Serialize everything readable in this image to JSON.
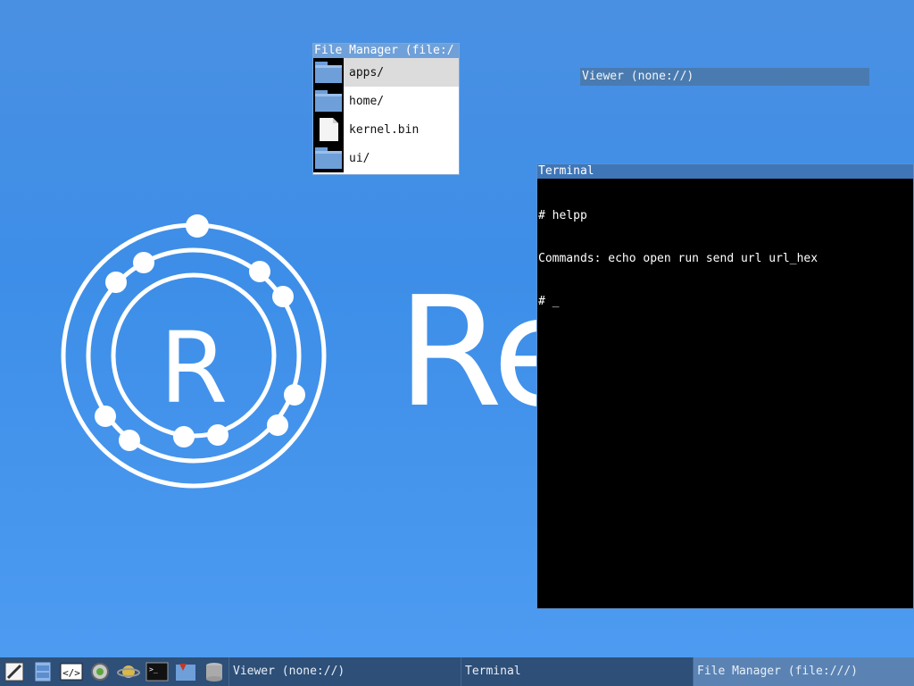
{
  "wallpaper": {
    "brand_text": "Re"
  },
  "file_manager": {
    "title": "File Manager (file:/",
    "entries": [
      {
        "label": "apps/",
        "icon": "folder-icon"
      },
      {
        "label": "home/",
        "icon": "folder-icon"
      },
      {
        "label": "kernel.bin",
        "icon": "file-icon"
      },
      {
        "label": "ui/",
        "icon": "folder-icon"
      }
    ]
  },
  "viewer": {
    "title": "Viewer (none://)"
  },
  "terminal": {
    "title": "Terminal",
    "lines": [
      "# helpp",
      "Commands: echo open run send url url_hex",
      "# _"
    ]
  },
  "taskbar": {
    "launchers": [
      "text-editor-icon",
      "file-manager-icon",
      "code-editor-icon",
      "settings-icon",
      "planet-icon",
      "terminal-icon",
      "paint-icon",
      "database-icon"
    ],
    "tasks": [
      {
        "label": "Viewer (none://)",
        "active": false
      },
      {
        "label": "Terminal",
        "active": false
      },
      {
        "label": "File Manager (file:///)",
        "active": true
      }
    ]
  }
}
